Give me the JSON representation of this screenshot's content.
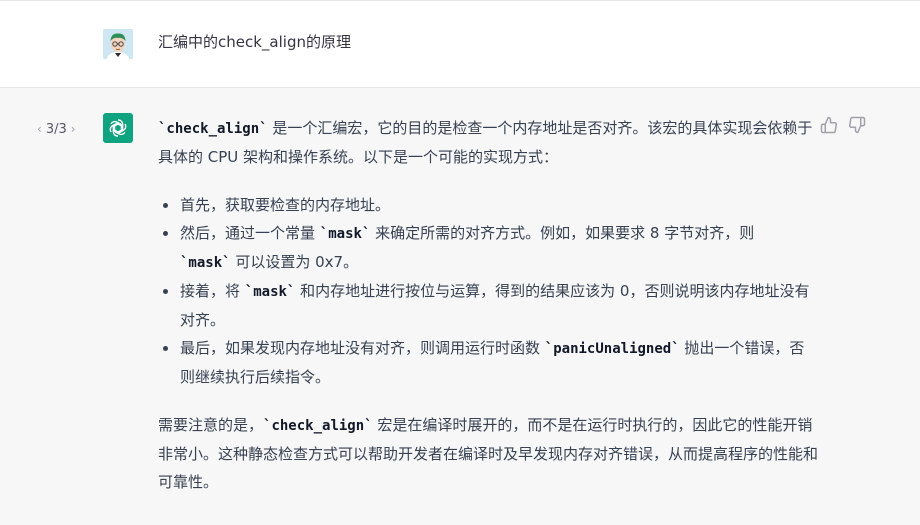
{
  "user": {
    "avatar_icon": "user-avatar-icon",
    "message": "汇编中的check_align的原理"
  },
  "assistant": {
    "avatar_icon": "openai-logo-icon",
    "pager": {
      "current": "3/3"
    },
    "feedback": {
      "like_icon": "thumbs-up-icon",
      "dislike_icon": "thumbs-down-icon"
    },
    "intro": {
      "code": "`check_align`",
      "text": " 是一个汇编宏，它的目的是检查一个内存地址是否对齐。该宏的具体实现会依赖于具体的 CPU 架构和操作系统。以下是一个可能的实现方式："
    },
    "bullets": [
      {
        "t1": "首先，获取要检查的内存地址。"
      },
      {
        "t1": "然后，通过一个常量",
        "code1": "`mask`",
        "t2": " 来确定所需的对齐方式。例如，如果要求 8 字节对齐，则 ",
        "code2": "`mask`",
        "t3": " 可以设置为 0x7。"
      },
      {
        "t1": "接着，将 ",
        "code1": "`mask`",
        "t2": " 和内存地址进行按位与运算，得到的结果应该为 0，否则说明该内存地址没有对齐。"
      },
      {
        "t1": "最后，如果发现内存地址没有对齐，则调用运行时函数 ",
        "code1": "`panicUnaligned`",
        "t2": " 抛出一个错误，否则继续执行后续指令。"
      }
    ],
    "conclusion": {
      "t1": "需要注意的是，",
      "code": "`check_align`",
      "t2": " 宏是在编译时展开的，而不是在运行时执行的，因此它的性能开销非常小。这种静态检查方式可以帮助开发者在编译时及早发现内存对齐错误，从而提高程序的性能和可靠性。"
    }
  }
}
